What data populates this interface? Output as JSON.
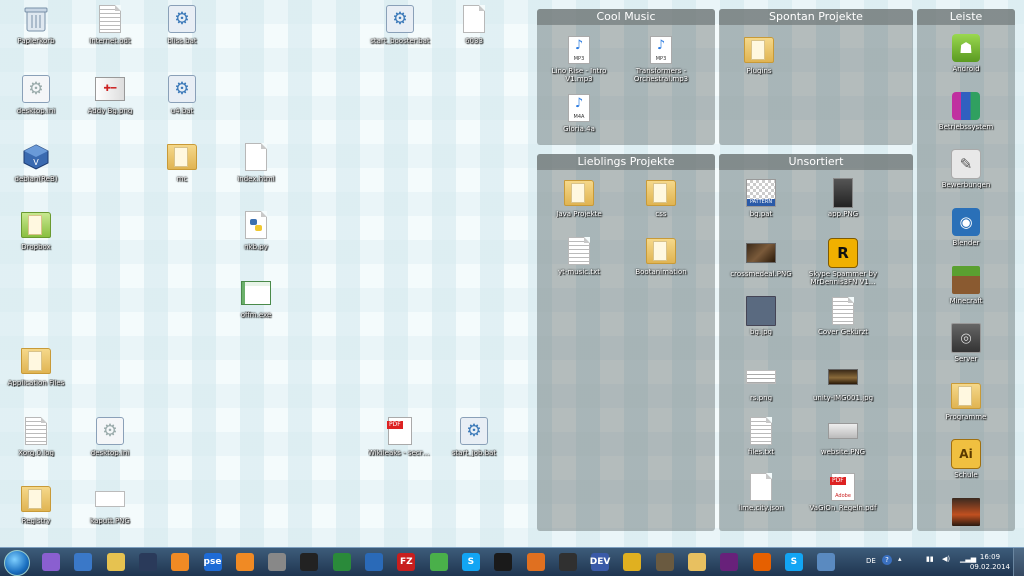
{
  "desktop_icons": [
    {
      "label": "Papierkorb",
      "icon": "recycle-bin-icon"
    },
    {
      "label": "Internet.odt",
      "icon": "document-icon"
    },
    {
      "label": "bliss.bat",
      "icon": "batch-file-icon"
    },
    {
      "label": "start_booster.bat",
      "icon": "batch-file-icon"
    },
    {
      "label": "6033",
      "icon": "blank-file-icon"
    },
    {
      "label": "desktop.ini",
      "icon": "settings-file-icon"
    },
    {
      "label": "Addy Bg.png",
      "icon": "image-file-icon"
    },
    {
      "label": "u4.bat",
      "icon": "batch-file-icon"
    },
    {
      "label": "debian(ReB)",
      "icon": "virtualbox-icon"
    },
    {
      "label": "mc",
      "icon": "folder-icon"
    },
    {
      "label": "index.html",
      "icon": "blank-file-icon"
    },
    {
      "label": "Dropbox",
      "icon": "dropbox-folder-icon"
    },
    {
      "label": "nkb.py",
      "icon": "python-file-icon"
    },
    {
      "label": "offm.exe",
      "icon": "exe-file-icon"
    },
    {
      "label": "Application Files",
      "icon": "folder-icon"
    },
    {
      "label": "Xorg.0.log",
      "icon": "text-file-icon"
    },
    {
      "label": "desktop.ini",
      "icon": "settings-file-icon"
    },
    {
      "label": "Wikileaks - secret ...",
      "icon": "pdf-file-icon"
    },
    {
      "label": "start_job.bat",
      "icon": "batch-file-icon"
    },
    {
      "label": "Registry",
      "icon": "folder-icon"
    },
    {
      "label": "kaputt.PNG",
      "icon": "image-file-icon"
    }
  ],
  "fences": {
    "cool_music": {
      "title": "Cool Music",
      "items": [
        {
          "label": "Lino Rise - Intro V1.mp3",
          "icon": "mp3-file-icon",
          "tag": "MP3"
        },
        {
          "label": "Transformers - Orchestral.mp3",
          "icon": "mp3-file-icon",
          "tag": "MP3"
        },
        {
          "label": "Gloria.4a",
          "icon": "m4a-file-icon",
          "tag": "M4A"
        }
      ]
    },
    "spontan": {
      "title": "Spontan Projekte",
      "items": [
        {
          "label": "Plugins",
          "icon": "folder-icon"
        }
      ]
    },
    "leiste": {
      "title": "Leiste",
      "items": [
        {
          "label": "Android",
          "icon": "android-icon"
        },
        {
          "label": "Betriebssystem",
          "icon": "winrar-icon"
        },
        {
          "label": "Bewerbungen",
          "icon": "pen-icon"
        },
        {
          "label": "Blender",
          "icon": "blender-icon"
        },
        {
          "label": "Minecraft",
          "icon": "minecraft-icon"
        },
        {
          "label": "Server",
          "icon": "server-icon"
        },
        {
          "label": "Programme",
          "icon": "folder-icon"
        },
        {
          "label": "Schule",
          "icon": "school-icon"
        },
        {
          "label": "",
          "icon": "gallery-icon"
        }
      ]
    },
    "lieblings": {
      "title": "Lieblings Projekte",
      "items": [
        {
          "label": "Java Projekte",
          "icon": "folder-icon"
        },
        {
          "label": "css",
          "icon": "folder-icon"
        },
        {
          "label": "yt-music.txt",
          "icon": "text-file-icon"
        },
        {
          "label": "Bootanimation",
          "icon": "folder-icon"
        }
      ]
    },
    "unsortiert": {
      "title": "Unsortiert",
      "items": [
        {
          "label": "bg.pat",
          "icon": "pattern-file-icon",
          "tag": "PATTERN"
        },
        {
          "label": "app.PNG",
          "icon": "image-file-icon"
        },
        {
          "label": "crossmedeal.PNG",
          "icon": "image-file-icon"
        },
        {
          "label": "Skype Spammer by MrDennis3FN V1...",
          "icon": "rockstar-icon"
        },
        {
          "label": "bg.jpg",
          "icon": "image-file-icon"
        },
        {
          "label": "Cover Gekürzt",
          "icon": "text-file-icon"
        },
        {
          "label": "rs.png",
          "icon": "image-file-icon"
        },
        {
          "label": "unity-IMG001.jpg",
          "icon": "image-file-icon"
        },
        {
          "label": "files.txt",
          "icon": "text-file-icon"
        },
        {
          "label": "website.PNG",
          "icon": "image-file-icon"
        },
        {
          "label": "lime.city.json",
          "icon": "blank-file-icon"
        },
        {
          "label": "VaGiOn_Regeln.pdf",
          "icon": "pdf-file-icon",
          "tag": "Adobe"
        }
      ]
    }
  },
  "taskbar": {
    "pinned": [
      {
        "name": "window-switcher-icon",
        "text": "",
        "color": "#8a5fd0"
      },
      {
        "name": "virtualbox-taskbar-icon",
        "text": "",
        "color": "#3a78c8"
      },
      {
        "name": "explorer-icon",
        "text": "",
        "color": "#e6c250"
      },
      {
        "name": "steam-icon",
        "text": "",
        "color": "#2a3a5a"
      },
      {
        "name": "media-player-icon",
        "text": "",
        "color": "#f08a24"
      },
      {
        "name": "pse-icon",
        "text": "pse",
        "color": "#1e6bd6"
      },
      {
        "name": "blender-taskbar-icon",
        "text": "",
        "color": "#f08a24"
      },
      {
        "name": "inkscape-icon",
        "text": "",
        "color": "#888888"
      },
      {
        "name": "unity-icon",
        "text": "",
        "color": "#222222"
      },
      {
        "name": "pixel-editor-icon",
        "text": "",
        "color": "#2a8a3a"
      },
      {
        "name": "shark-icon",
        "text": "",
        "color": "#2a6ab8"
      },
      {
        "name": "filezilla-icon",
        "text": "FZ",
        "color": "#c81e1e"
      },
      {
        "name": "task-monitor-icon",
        "text": "",
        "color": "#4ab04a"
      },
      {
        "name": "skype-icon",
        "text": "S",
        "color": "#12a5f4"
      },
      {
        "name": "headphones-icon",
        "text": "",
        "color": "#1a1a1a"
      },
      {
        "name": "butterfly-icon",
        "text": "",
        "color": "#e07020"
      },
      {
        "name": "obs-icon",
        "text": "",
        "color": "#303030"
      },
      {
        "name": "dev-cpp-icon",
        "text": "DEV",
        "color": "#3a5aa8"
      },
      {
        "name": "puzzle-icon",
        "text": "",
        "color": "#e0b020"
      },
      {
        "name": "gimp-icon",
        "text": "",
        "color": "#6a5a40"
      },
      {
        "name": "file-explorer-icon",
        "text": "",
        "color": "#e8c060"
      },
      {
        "name": "visual-studio-icon",
        "text": "",
        "color": "#68217a"
      },
      {
        "name": "firefox-icon",
        "text": "",
        "color": "#e66000"
      },
      {
        "name": "skype-active-icon",
        "text": "S",
        "color": "#12a5f4"
      },
      {
        "name": "window-icon",
        "text": "",
        "color": "#5a8ac0"
      }
    ],
    "tray": {
      "language": "DE",
      "time": "16:09",
      "date": "09.02.2014"
    }
  }
}
